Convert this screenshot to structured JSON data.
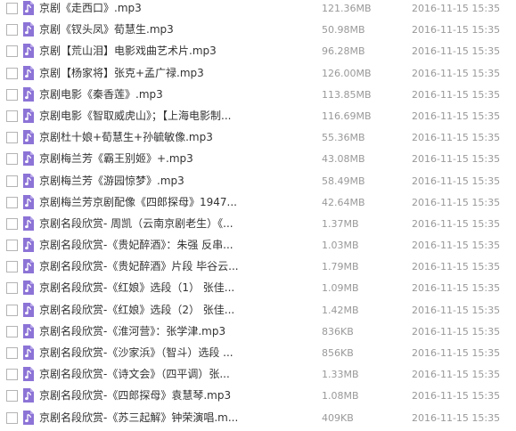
{
  "file_list": {
    "icon": "music-file-icon",
    "icon_color": "#8c73d6",
    "rows": [
      {
        "name": "京剧《走西口》.mp3",
        "size": "121.36MB",
        "date": "2016-11-15 15:35"
      },
      {
        "name": "京剧《钗头凤》荀慧生.mp3",
        "size": "50.98MB",
        "date": "2016-11-15 15:35"
      },
      {
        "name": "京剧【荒山泪】电影戏曲艺术片.mp3",
        "size": "96.28MB",
        "date": "2016-11-15 15:35"
      },
      {
        "name": "京剧【杨家将】张克+孟广禄.mp3",
        "size": "126.00MB",
        "date": "2016-11-15 15:35"
      },
      {
        "name": "京剧电影《秦香莲》.mp3",
        "size": "113.85MB",
        "date": "2016-11-15 15:35"
      },
      {
        "name": "京剧电影《智取威虎山》；【上海电影制...",
        "size": "116.69MB",
        "date": "2016-11-15 15:35"
      },
      {
        "name": "京剧杜十娘+荀慧生+孙毓敏像.mp3",
        "size": "55.36MB",
        "date": "2016-11-15 15:35"
      },
      {
        "name": "京剧梅兰芳《霸王别姬》+.mp3",
        "size": "43.08MB",
        "date": "2016-11-15 15:35"
      },
      {
        "name": "京剧梅兰芳《游园惊梦》.mp3",
        "size": "58.49MB",
        "date": "2016-11-15 15:35"
      },
      {
        "name": "京剧梅兰芳京剧配像《四郎探母》1947...",
        "size": "42.64MB",
        "date": "2016-11-15 15:35"
      },
      {
        "name": "京剧名段欣赏- 周凯（云南京剧老生）《...",
        "size": "1.37MB",
        "date": "2016-11-15 15:35"
      },
      {
        "name": "京剧名段欣赏-《贵妃醉酒》：朱强 反串...",
        "size": "1.03MB",
        "date": "2016-11-15 15:35"
      },
      {
        "name": "京剧名段欣赏-《贵妃醉酒》片段 毕谷云...",
        "size": "1.79MB",
        "date": "2016-11-15 15:35"
      },
      {
        "name": "京剧名段欣赏-《红娘》选段（1） 张佳...",
        "size": "1.09MB",
        "date": "2016-11-15 15:35"
      },
      {
        "name": "京剧名段欣赏-《红娘》选段（2） 张佳...",
        "size": "1.42MB",
        "date": "2016-11-15 15:35"
      },
      {
        "name": "京剧名段欣赏-《淮河营》：张学津.mp3",
        "size": "836KB",
        "date": "2016-11-15 15:35"
      },
      {
        "name": "京剧名段欣赏-《沙家浜》（智斗）选段 ...",
        "size": "856KB",
        "date": "2016-11-15 15:35"
      },
      {
        "name": "京剧名段欣赏-《诗文会》（四平调）张...",
        "size": "1.33MB",
        "date": "2016-11-15 15:35"
      },
      {
        "name": "京剧名段欣赏-《四郎探母》袁慧琴.mp3",
        "size": "1.08MB",
        "date": "2016-11-15 15:35"
      },
      {
        "name": "京剧名段欣赏-《苏三起解》钟荣演唱.m...",
        "size": "409KB",
        "date": "2016-11-15 15:35"
      }
    ]
  }
}
